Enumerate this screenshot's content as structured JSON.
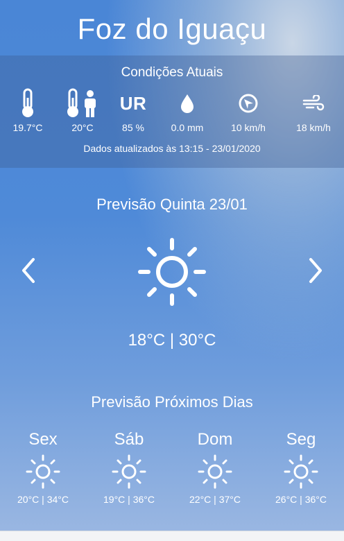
{
  "header": {
    "city": "Foz do Iguaçu"
  },
  "current": {
    "title": "Condições Atuais",
    "items": [
      {
        "icon": "thermometer-icon",
        "value": "19.7°C"
      },
      {
        "icon": "feels-like-icon",
        "value": "20°C"
      },
      {
        "icon": "humidity-ur-icon",
        "label": "UR",
        "value": "85 %"
      },
      {
        "icon": "rain-drop-icon",
        "value": "0.0 mm"
      },
      {
        "icon": "wind-direction-icon",
        "value": "10 km/h"
      },
      {
        "icon": "wind-gust-icon",
        "value": "18 km/h"
      }
    ],
    "updated": "Dados atualizados às 13:15 - 23/01/2020"
  },
  "forecast": {
    "title": "Previsão Quinta 23/01",
    "icon": "sun-icon",
    "temps": "18°C | 30°C"
  },
  "next_days": {
    "title": "Previsão Próximos Dias",
    "days": [
      {
        "name": "Sex",
        "icon": "sun-icon",
        "temps": "20°C | 34°C"
      },
      {
        "name": "Sáb",
        "icon": "sun-icon",
        "temps": "19°C | 36°C"
      },
      {
        "name": "Dom",
        "icon": "sun-icon",
        "temps": "22°C | 37°C"
      },
      {
        "name": "Seg",
        "icon": "sun-icon",
        "temps": "26°C | 36°C"
      }
    ]
  },
  "colors": {
    "background": "#4f8ad8",
    "text": "#ffffff",
    "panel": "rgba(60,90,140,0.35)"
  }
}
